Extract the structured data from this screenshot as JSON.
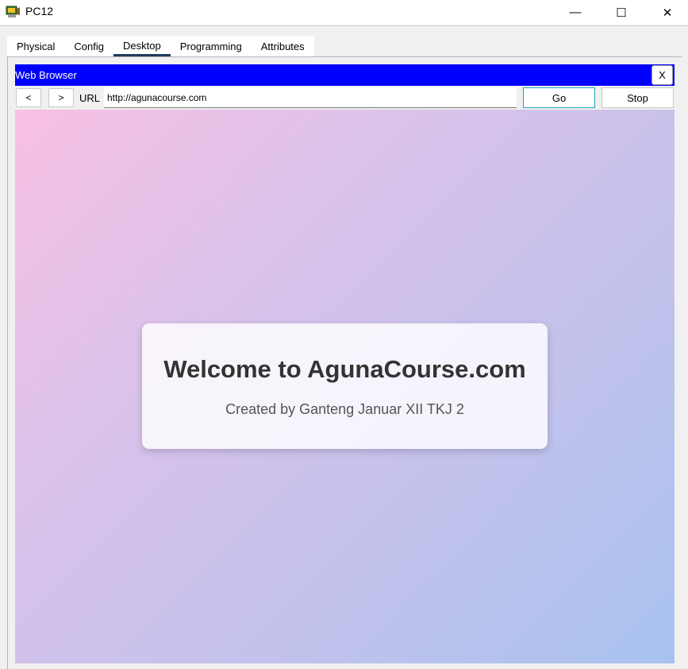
{
  "window": {
    "title": "PC12",
    "minimize_glyph": "—",
    "maximize_glyph": "☐",
    "close_glyph": "✕"
  },
  "tabs": [
    {
      "label": "Physical"
    },
    {
      "label": "Config"
    },
    {
      "label": "Desktop",
      "active": true
    },
    {
      "label": "Programming"
    },
    {
      "label": "Attributes"
    }
  ],
  "browser": {
    "title": "Web Browser",
    "close_label": "X",
    "back_label": "<",
    "forward_label": ">",
    "url_label": "URL",
    "url_value": "http://agunacourse.com",
    "go_label": "Go",
    "stop_label": "Stop"
  },
  "page": {
    "heading": "Welcome to AgunaCourse.com",
    "subtitle": "Created by Ganteng Januar XII TKJ 2"
  },
  "colors": {
    "browser_header": "#0000ff",
    "active_tab_underline": "#1f3b5c",
    "go_button_border": "#1fa3c4",
    "gradient_start": "#f8c0e4",
    "gradient_end": "#a8c2ee"
  }
}
